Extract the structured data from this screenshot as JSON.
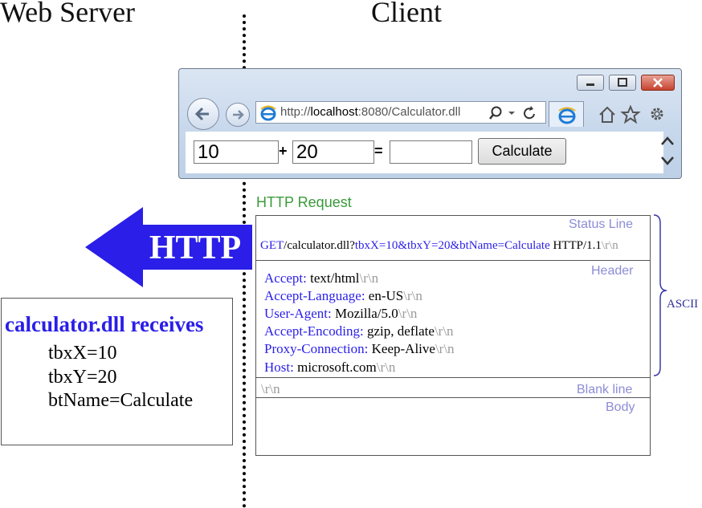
{
  "titles": {
    "left": "Web Server",
    "right": "Client"
  },
  "browser": {
    "address_prefix": "http://",
    "address_host": "localhost",
    "address_rest": ":8080/Calculator.dll",
    "input_x": "10",
    "plus": "+",
    "input_y": "20",
    "equals": "=",
    "input_result": "",
    "calculate_label": "Calculate"
  },
  "arrow": {
    "label": "HTTP",
    "color": "#2a1ee8"
  },
  "request": {
    "title": "HTTP Request",
    "status_line_label": "Status Line",
    "status_line": {
      "method": "GET",
      "path": "/calculator.dll?",
      "query": "tbxX=10&tbxY=20&btName=Calculate",
      "version": " HTTP/1.1",
      "crlf": "\\r\\n"
    },
    "header_label": "Header",
    "headers": [
      {
        "name": "Accept:",
        "value": " text/html",
        "crlf": "\\r\\n"
      },
      {
        "name": "Accept-Language:",
        "value": " en-US",
        "crlf": "\\r\\n"
      },
      {
        "name": "User-Agent:",
        "value": " Mozilla/5.0",
        "crlf": "\\r\\n"
      },
      {
        "name": "Accept-Encoding:",
        "value": " gzip, deflate",
        "crlf": "\\r\\n"
      },
      {
        "name": "Proxy-Connection:",
        "value": " Keep-Alive",
        "crlf": "\\r\\n"
      },
      {
        "name": "Host:",
        "value": " microsoft.com",
        "crlf": "\\r\\n"
      }
    ],
    "blank_crlf": "\\r\\n",
    "blank_line_label": "Blank line",
    "body_label": "Body",
    "ascii_label": "ASCII"
  },
  "receiver": {
    "title": "calculator.dll receives",
    "lines": [
      "tbxX=10",
      "tbxY=20",
      "btName=Calculate"
    ]
  },
  "colors": {
    "keyword": "#2a1ee8",
    "section_label": "#8c8cd8",
    "request_title": "#3a9a3a",
    "crlf": "#9a9a9a"
  }
}
